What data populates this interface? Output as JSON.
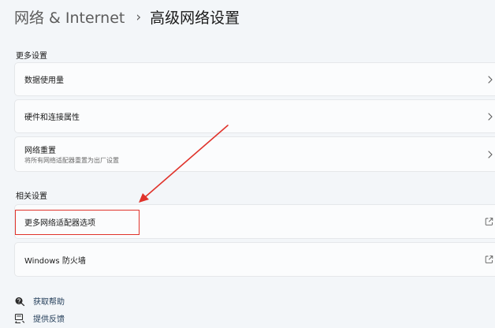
{
  "breadcrumb": {
    "parent": "网络 & Internet",
    "separator": "›",
    "current": "高级网络设置"
  },
  "sections": {
    "more_settings": {
      "title": "更多设置",
      "items": [
        {
          "title": "数据使用量"
        },
        {
          "title": "硬件和连接属性"
        },
        {
          "title": "网络重置",
          "subtitle": "将所有网络适配器重置为出厂设置"
        }
      ]
    },
    "related_settings": {
      "title": "相关设置",
      "items": [
        {
          "title": "更多网络适配器选项"
        },
        {
          "title": "Windows 防火墙"
        }
      ]
    }
  },
  "footer_links": [
    {
      "label": "获取帮助",
      "icon": "help-icon"
    },
    {
      "label": "提供反馈",
      "icon": "feedback-icon"
    }
  ],
  "colors": {
    "annotation_red": "#e0332b",
    "card_bg": "#fbfcfd",
    "page_bg": "#f3f6f9",
    "link_text": "#1f3a56"
  }
}
